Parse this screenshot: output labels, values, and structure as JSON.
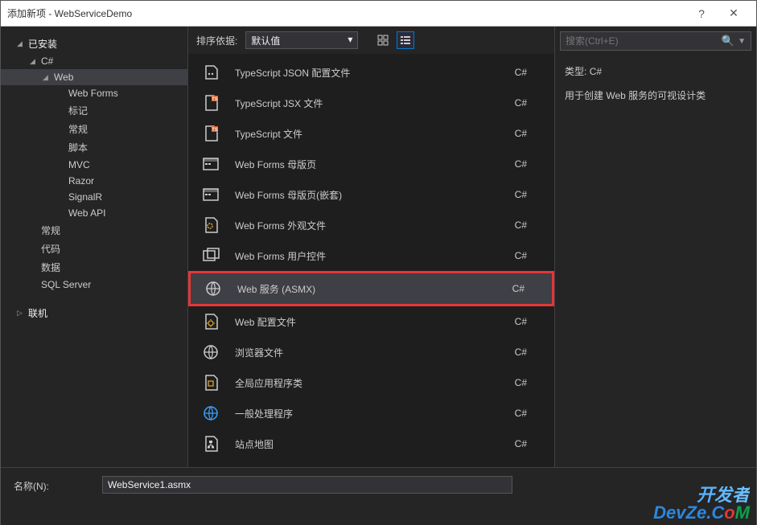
{
  "window": {
    "title": "添加新项 - WebServiceDemo"
  },
  "sidebar": {
    "installed_label": "已安装",
    "nodes": [
      {
        "label": "C#",
        "expanded": true,
        "level": 2
      },
      {
        "label": "Web",
        "selected": true,
        "expanded": true,
        "level": 3
      },
      {
        "label": "Web Forms",
        "level": 4
      },
      {
        "label": "标记",
        "level": 4
      },
      {
        "label": "常规",
        "level": 4
      },
      {
        "label": "脚本",
        "level": 4
      },
      {
        "label": "MVC",
        "level": 4
      },
      {
        "label": "Razor",
        "level": 4
      },
      {
        "label": "SignalR",
        "level": 4
      },
      {
        "label": "Web API",
        "level": 4
      },
      {
        "label": "常规",
        "level": 2
      },
      {
        "label": "代码",
        "level": 2
      },
      {
        "label": "数据",
        "level": 2
      },
      {
        "label": "SQL Server",
        "level": 2
      }
    ],
    "online_label": "联机"
  },
  "toolbar": {
    "sort_label": "排序依据:",
    "sort_value": "默认值"
  },
  "templates": [
    {
      "icon": "json",
      "label": "TypeScript JSON 配置文件",
      "lang": "C#"
    },
    {
      "icon": "ts",
      "label": "TypeScript JSX 文件",
      "lang": "C#"
    },
    {
      "icon": "ts",
      "label": "TypeScript 文件",
      "lang": "C#"
    },
    {
      "icon": "master",
      "label": "Web Forms 母版页",
      "lang": "C#"
    },
    {
      "icon": "master",
      "label": "Web Forms 母版页(嵌套)",
      "lang": "C#"
    },
    {
      "icon": "skin",
      "label": "Web Forms 外观文件",
      "lang": "C#"
    },
    {
      "icon": "control",
      "label": "Web Forms 用户控件",
      "lang": "C#"
    },
    {
      "icon": "globe",
      "label": "Web 服务 (ASMX)",
      "lang": "C#",
      "selected": true,
      "highlighted": true
    },
    {
      "icon": "config",
      "label": "Web 配置文件",
      "lang": "C#"
    },
    {
      "icon": "globe",
      "label": "浏览器文件",
      "lang": "C#"
    },
    {
      "icon": "app",
      "label": "全局应用程序类",
      "lang": "C#"
    },
    {
      "icon": "globe-blue",
      "label": "一般处理程序",
      "lang": "C#"
    },
    {
      "icon": "sitemap",
      "label": "站点地图",
      "lang": "C#"
    }
  ],
  "search": {
    "placeholder": "搜索(Ctrl+E)"
  },
  "info": {
    "type_label": "类型:",
    "type_value": "C#",
    "description": "用于创建 Web 服务的可视设计类"
  },
  "footer": {
    "name_label": "名称(N):",
    "name_value": "WebService1.asmx"
  },
  "watermark": {
    "line1": "开发者",
    "line2_prefix": "DevZe.C",
    "line2_o": "o",
    "line2_m": "M"
  }
}
